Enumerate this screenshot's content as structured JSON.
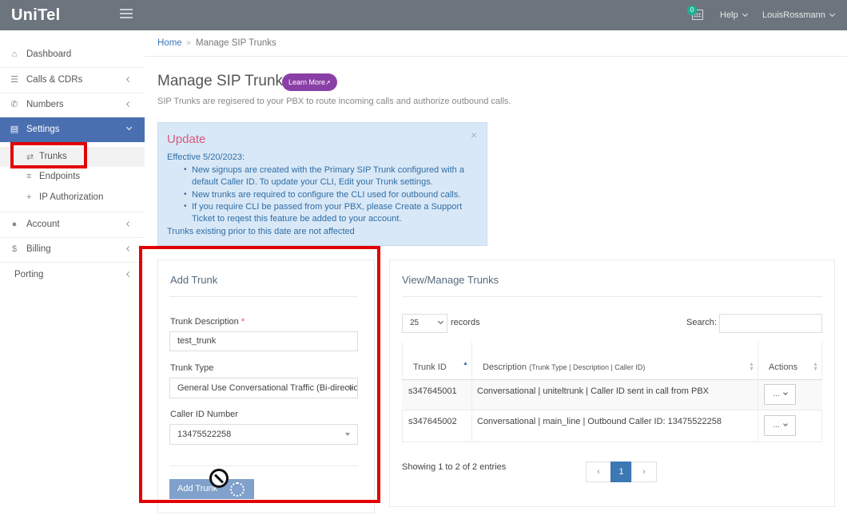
{
  "app": {
    "brand": "UniTel"
  },
  "topbar": {
    "notification_count": "0",
    "help_label": "Help",
    "user_label": "LouisRossmann"
  },
  "sidebar": {
    "items": [
      {
        "label": "Dashboard",
        "icon": "home-icon"
      },
      {
        "label": "Calls & CDRs",
        "icon": "list-icon"
      },
      {
        "label": "Numbers",
        "icon": "phone-icon"
      },
      {
        "label": "Settings",
        "icon": "server-icon"
      },
      {
        "label": "Account",
        "icon": "user-icon"
      },
      {
        "label": "Billing",
        "icon": "dollar-icon"
      },
      {
        "label": "Porting"
      }
    ],
    "settings_sub": [
      {
        "label": "Trunks",
        "icon": "exchange-icon"
      },
      {
        "label": "Endpoints",
        "icon": "list-icon"
      },
      {
        "label": "IP Authorization",
        "icon": "plus-icon"
      }
    ]
  },
  "breadcrumb": {
    "home": "Home",
    "separator": "»",
    "current": "Manage SIP Trunks"
  },
  "header": {
    "title": "Manage SIP Trunks",
    "learn_more": "Learn More",
    "description": "SIP Trunks are regisered to your PBX to route incoming calls and authorize outbound calls."
  },
  "alert": {
    "title": "Update",
    "close": "×",
    "effective": "Effective 5/20/2023:",
    "bullet_1a": "New signups are created with the Primary SIP Trunk configured with a",
    "bullet_1b": "default Caller ID. To update your CLI, Edit your Trunk settings.",
    "bullet_2": "New trunks are required to configure the CLI used for outbound calls.",
    "bullet_3a": "If you require CLI be passed from your PBX, please Create a Support",
    "bullet_3b": "Ticket to reqest this feature be added to your account.",
    "footer": "Trunks existing prior to this date are not affected"
  },
  "add_trunk": {
    "heading": "Add Trunk",
    "description_label": "Trunk Description",
    "required_mark": "*",
    "description_value": "test_trunk",
    "type_label": "Trunk Type",
    "type_value": "General Use Conversational Traffic (Bi-directional)",
    "caller_id_label": "Caller ID Number",
    "caller_id_value": "13475522258",
    "submit_label": "Add Trunk"
  },
  "manage": {
    "heading": "View/Manage Trunks",
    "page_size": "25",
    "records_label": "records",
    "search_label": "Search:",
    "columns": {
      "id": "Trunk ID",
      "desc": "Description",
      "desc_sub": "(Trunk Type | Description | Caller ID)",
      "actions": "Actions"
    },
    "rows": [
      {
        "id": "s347645001",
        "desc": "Conversational | uniteltrunk | Caller ID sent in call from PBX",
        "action": "..."
      },
      {
        "id": "s347645002",
        "desc": "Conversational | main_line | Outbound Caller ID: 13475522258",
        "action": "..."
      }
    ],
    "summary": "Showing 1 to 2 of 2 entries",
    "pagination": {
      "prev": "‹",
      "current": "1",
      "next": "›"
    }
  }
}
